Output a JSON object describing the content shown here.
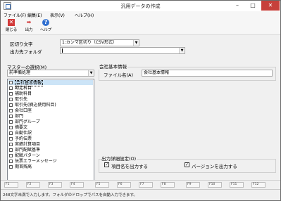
{
  "window": {
    "title": "汎用データの作成"
  },
  "menu": [
    {
      "label": "ファイル(F)"
    },
    {
      "label": "編集(E)"
    },
    {
      "label": "表示(V)"
    },
    {
      "label": "ヘルプ(H)"
    }
  ],
  "toolbar": {
    "close_label": "閉じる",
    "output_label": "出力",
    "help_label": "ヘルプ"
  },
  "form": {
    "delimiter_label": "区切り文字",
    "delimiter_value": "1:カンマ区切り（CSV形式）",
    "output_folder_label": "出力先フォルダ",
    "output_folder_value": ""
  },
  "master": {
    "group_label": "マスターの選択(M)",
    "category_value": "前準備処理",
    "items": [
      {
        "label": "会社基本情報",
        "checked": false,
        "selected": true
      },
      {
        "label": "勘定科目",
        "checked": false
      },
      {
        "label": "補助科目",
        "checked": false
      },
      {
        "label": "取引先",
        "checked": false
      },
      {
        "label": "取引先(摘込使用科目)",
        "checked": false
      },
      {
        "label": "会社口座",
        "checked": false
      },
      {
        "label": "部門",
        "checked": false
      },
      {
        "label": "部門グループ",
        "checked": false
      },
      {
        "label": "摘要文",
        "checked": false
      },
      {
        "label": "自動仕訳",
        "checked": false
      },
      {
        "label": "予約伝票",
        "checked": false
      },
      {
        "label": "実績計算項目",
        "checked": false
      },
      {
        "label": "部門配賦基準",
        "checked": false
      },
      {
        "label": "配賦パターン",
        "checked": false
      },
      {
        "label": "伝票エラーメッセージ",
        "checked": false
      },
      {
        "label": "期首残高",
        "checked": false
      }
    ]
  },
  "info": {
    "group_label": "会社基本情報",
    "filename_label": "ファイル名(A)",
    "filename_value": "会社基本情報"
  },
  "output_settings": {
    "group_label": "出力詳細設定(O)",
    "item_name_label": "項目名を出力する",
    "item_name_checked": true,
    "version_label": "バージョンを出力する",
    "version_checked": true
  },
  "fkeys": [
    "F1",
    "F2",
    "F3",
    "F4",
    "F5",
    "F6",
    "F7",
    "F8",
    "F9",
    "F10",
    "F11",
    "F12"
  ],
  "status": {
    "text": "248文字未満で入力します。フォルダのドロップでパスを自動入力できます。"
  }
}
